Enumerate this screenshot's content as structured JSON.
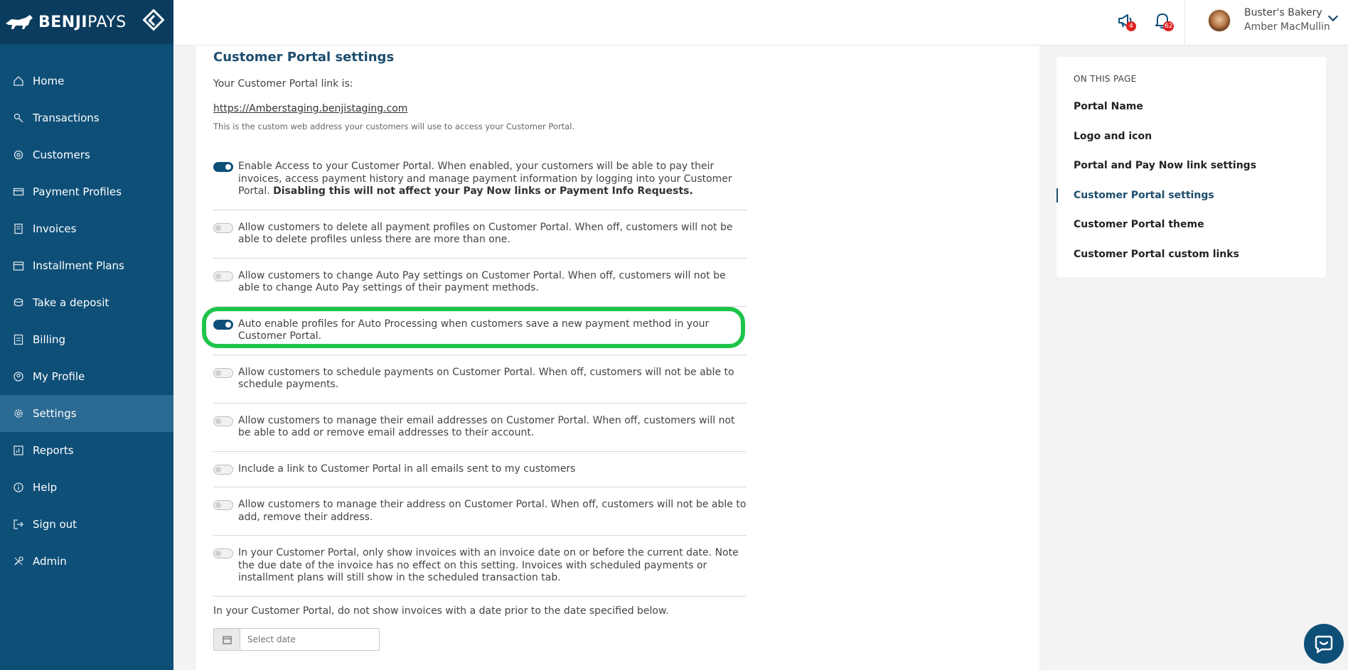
{
  "brand": {
    "name_bold": "BENJI",
    "name_light": "PAYS"
  },
  "sidebar": {
    "items": [
      {
        "label": "Home",
        "icon": "home-icon"
      },
      {
        "label": "Transactions",
        "icon": "transactions-icon"
      },
      {
        "label": "Customers",
        "icon": "customers-icon"
      },
      {
        "label": "Payment Profiles",
        "icon": "card-icon"
      },
      {
        "label": "Invoices",
        "icon": "invoice-icon"
      },
      {
        "label": "Installment Plans",
        "icon": "calendar-icon"
      },
      {
        "label": "Take a deposit",
        "icon": "deposit-icon"
      },
      {
        "label": "Billing",
        "icon": "billing-icon"
      },
      {
        "label": "My Profile",
        "icon": "profile-icon"
      },
      {
        "label": "Settings",
        "icon": "gear-icon",
        "active": true
      },
      {
        "label": "Reports",
        "icon": "reports-icon"
      },
      {
        "label": "Help",
        "icon": "info-icon"
      },
      {
        "label": "Sign out",
        "icon": "sign-out-icon"
      },
      {
        "label": "Admin",
        "icon": "tools-icon"
      }
    ]
  },
  "topbar": {
    "announcements_count": "4",
    "notifications_count": "62",
    "company": "Buster's Bakery",
    "user": "Amber MacMullin"
  },
  "main": {
    "title": "Customer Portal settings",
    "link_label": "Your Customer Portal link is:",
    "link_url": "https://Amberstaging.benjistaging.com",
    "link_help": "This is the custom web address your customers will use to access your Customer Portal.",
    "settings": [
      {
        "text": "Enable Access to your Customer Portal. When enabled, your customers will be able to pay their invoices, access payment history and manage payment information by logging into your Customer Portal. ",
        "bold": "Disabling this will not affect your Pay Now links or Payment Info Requests.",
        "on": true
      },
      {
        "text": "Allow customers to delete all payment profiles on Customer Portal. When off, customers will not be able to delete profiles unless there are more than one.",
        "on": false
      },
      {
        "text": "Allow customers to change Auto Pay settings on Customer Portal. When off, customers will not be able to change Auto Pay settings of their payment methods.",
        "on": false
      },
      {
        "text": "Auto enable profiles for Auto Processing when customers save a new payment method in your Customer Portal.",
        "on": true
      },
      {
        "text": "Allow customers to schedule payments on Customer Portal. When off, customers will not be able to schedule payments.",
        "on": false
      },
      {
        "text": "Allow customers to manage their email addresses on Customer Portal. When off, customers will not be able to add or remove email addresses to their account.",
        "on": false
      },
      {
        "text": "Include a link to Customer Portal in all emails sent to my customers",
        "on": false
      },
      {
        "text": "Allow customers to manage their address on Customer Portal. When off, customers will not be able to add, remove their address.",
        "on": false
      },
      {
        "text": "In your Customer Portal, only show invoices with an invoice date on or before the current date. Note the due date of the invoice has no effect on this setting. Invoices with scheduled payments or installment plans will still show in the scheduled transaction tab.",
        "on": false
      }
    ],
    "date_label": "In your Customer Portal, do not show invoices with a date prior to the date specified below.",
    "date_placeholder": "Select date"
  },
  "toc": {
    "title": "ON THIS PAGE",
    "items": [
      {
        "label": "Portal Name"
      },
      {
        "label": "Logo and icon"
      },
      {
        "label": "Portal and Pay Now link settings"
      },
      {
        "label": "Customer Portal settings",
        "active": true
      },
      {
        "label": "Customer Portal theme"
      },
      {
        "label": "Customer Portal custom links"
      }
    ]
  },
  "colors": {
    "sidebar": "#0e4f78",
    "brand_bar": "#0b3c5e",
    "accent": "#1d4d6e",
    "highlight": "#1ec44a",
    "badge": "#e02020"
  }
}
